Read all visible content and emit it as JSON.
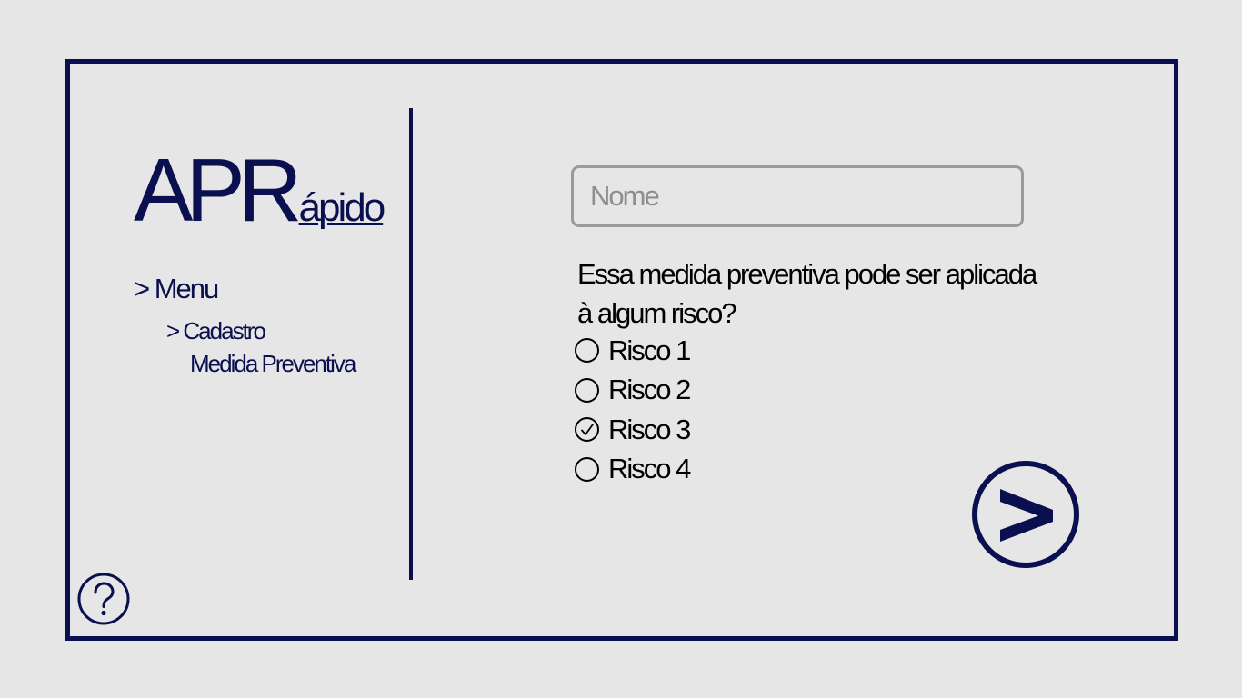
{
  "logo": {
    "main": "APR",
    "sub": "ápido"
  },
  "menu": {
    "top_label": "> Menu",
    "sub_line1": "> Cadastro",
    "sub_line2": "Medida Preventiva"
  },
  "form": {
    "name_placeholder": "Nome",
    "name_value": "",
    "question_line1": "Essa medida preventiva pode ser aplicada",
    "question_line2": "à algum risco?",
    "options": [
      {
        "label": "Risco 1",
        "checked": false
      },
      {
        "label": "Risco 2",
        "checked": false
      },
      {
        "label": "Risco 3",
        "checked": true
      },
      {
        "label": "Risco 4",
        "checked": false
      }
    ]
  },
  "icons": {
    "next": "chevron-right-icon",
    "help": "question-mark-icon"
  },
  "colors": {
    "accent": "#0a0f4f",
    "background": "#e6e6e6",
    "input_border": "#9a9a9a"
  }
}
